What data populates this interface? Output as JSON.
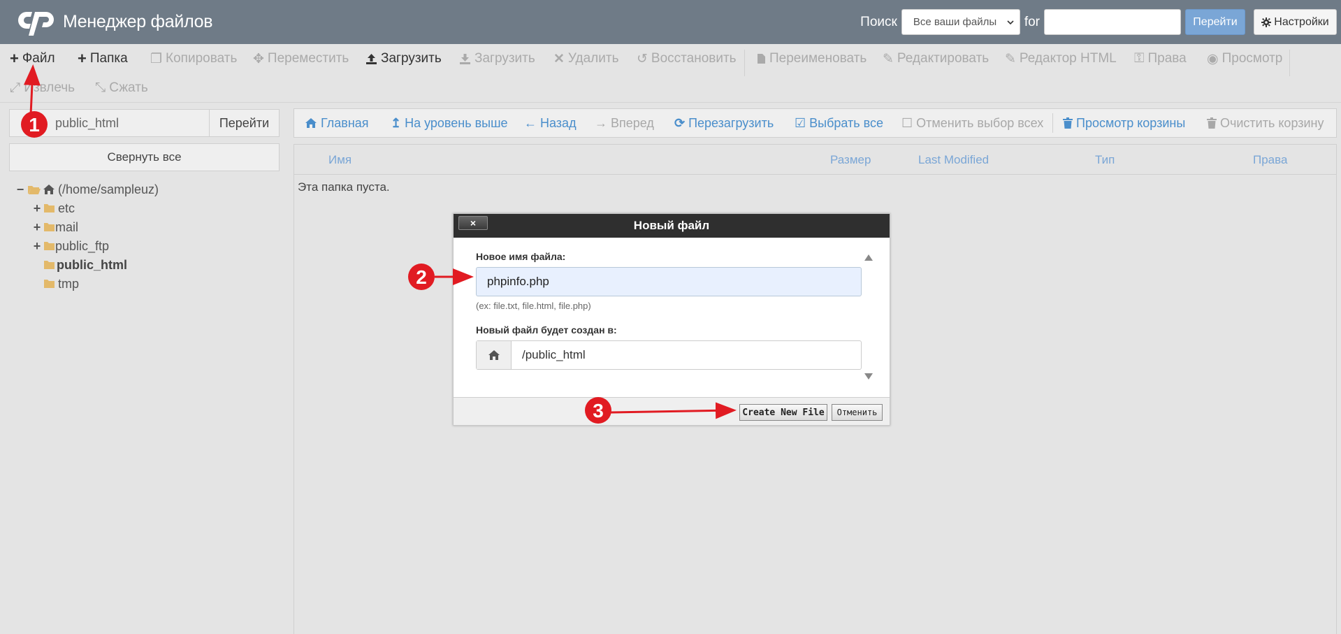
{
  "header": {
    "title": "Менеджер файлов",
    "search_label": "Поиск",
    "search_scope": "Все ваши файлы",
    "for_label": "for",
    "search_value": "",
    "go_label": "Перейти",
    "settings_label": "Настройки",
    "bg_color": "#6f7b87",
    "go_color": "#7aa6d6"
  },
  "toolbar": {
    "file": "Файл",
    "folder": "Папка",
    "copy": "Копировать",
    "move": "Переместить",
    "upload": "Загрузить",
    "download": "Загрузить",
    "delete": "Удалить",
    "restore": "Восстановить",
    "rename": "Переименовать",
    "edit": "Редактировать",
    "html_editor": "Редактор HTML",
    "permissions": "Права",
    "view": "Просмотр",
    "extract": "Извлечь",
    "compress": "Сжать"
  },
  "sidebar": {
    "path_value": "public_html",
    "path_go": "Перейти",
    "collapse_all": "Свернуть все",
    "tree": {
      "root": "(/home/sampleuz)",
      "items": [
        {
          "label": "etc",
          "expandable": true
        },
        {
          "label": "mail",
          "expandable": true
        },
        {
          "label": "public_ftp",
          "expandable": true
        },
        {
          "label": "public_html",
          "expandable": false,
          "selected": true
        },
        {
          "label": "tmp",
          "expandable": false
        }
      ]
    }
  },
  "nav": {
    "home": "Главная",
    "up": "На уровень выше",
    "back": "Назад",
    "forward": "Вперед",
    "reload": "Перезагрузить",
    "select_all": "Выбрать все",
    "deselect_all": "Отменить выбор всех",
    "view_trash": "Просмотр корзины",
    "empty_trash": "Очистить корзину"
  },
  "table": {
    "columns": [
      "Имя",
      "Размер",
      "Last Modified",
      "Тип",
      "Права"
    ],
    "empty_message": "Эта папка пуста."
  },
  "dialog": {
    "title": "Новый файл",
    "close": "×",
    "filename_label": "Новое имя файла:",
    "filename_value": "phpinfo.php",
    "filename_hint": "(ex: file.txt, file.html, file.php)",
    "location_label": "Новый файл будет создан в:",
    "location_value": "/public_html",
    "create_label": "Create New File",
    "cancel_label": "Отменить"
  },
  "annotations": {
    "color": "#e11b22",
    "steps": [
      "1",
      "2",
      "3"
    ]
  }
}
